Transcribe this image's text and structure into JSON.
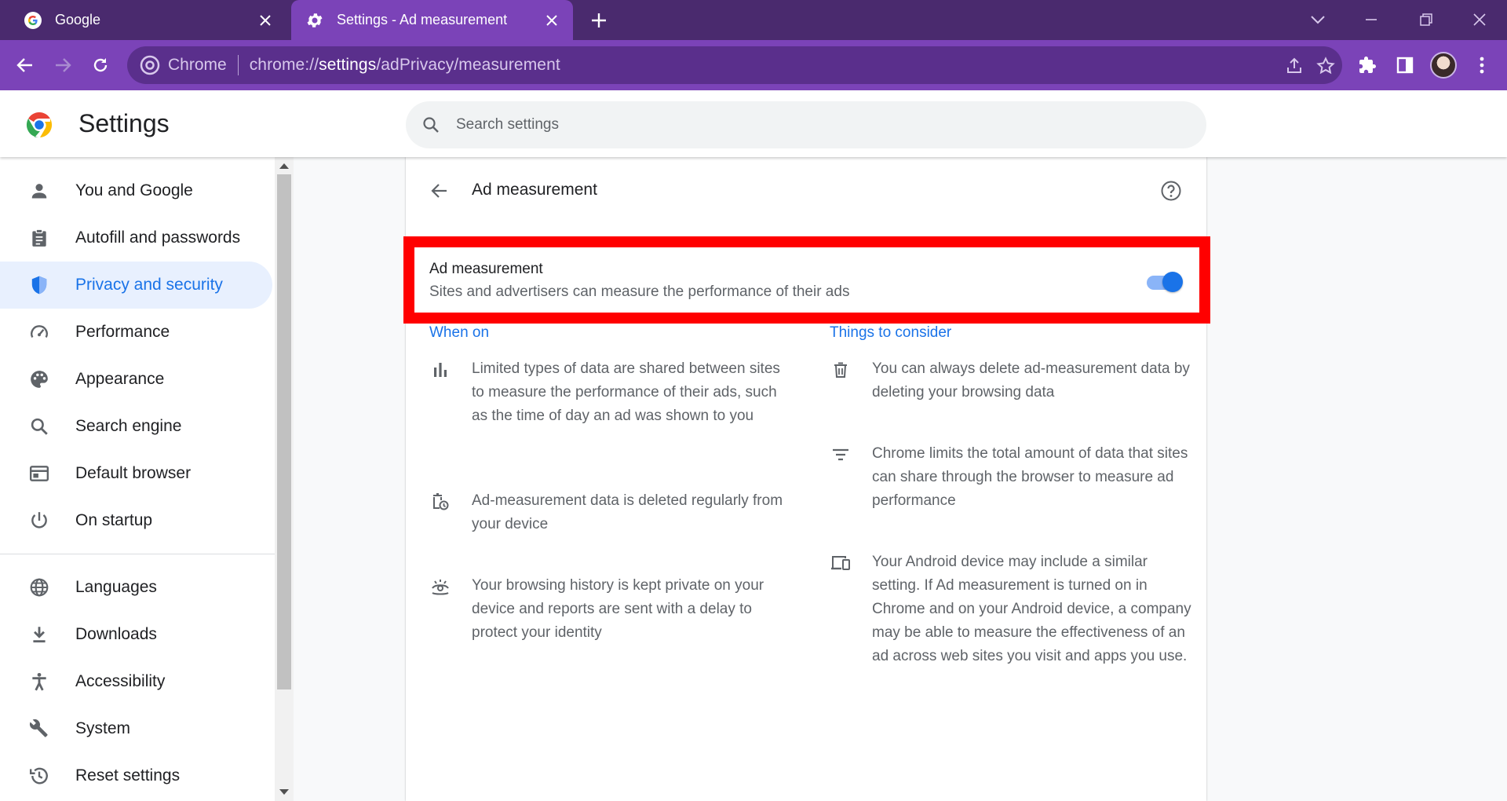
{
  "tabs": [
    {
      "title": "Google",
      "icon": "google-icon"
    },
    {
      "title": "Settings - Ad measurement",
      "icon": "gear-icon"
    }
  ],
  "omnibox": {
    "chip": "Chrome",
    "url_host": "chrome://",
    "url_bold": "settings",
    "url_path": "/adPrivacy/measurement"
  },
  "header": {
    "title": "Settings",
    "search_placeholder": "Search settings"
  },
  "sidebar": {
    "items": [
      {
        "label": "You and Google",
        "icon": "person-icon"
      },
      {
        "label": "Autofill and passwords",
        "icon": "clipboard-icon"
      },
      {
        "label": "Privacy and security",
        "icon": "shield-icon",
        "selected": true
      },
      {
        "label": "Performance",
        "icon": "speedometer-icon"
      },
      {
        "label": "Appearance",
        "icon": "palette-icon"
      },
      {
        "label": "Search engine",
        "icon": "search-icon"
      },
      {
        "label": "Default browser",
        "icon": "browser-window-icon"
      },
      {
        "label": "On startup",
        "icon": "power-icon"
      },
      {
        "label": "Languages",
        "icon": "globe-icon"
      },
      {
        "label": "Downloads",
        "icon": "download-icon"
      },
      {
        "label": "Accessibility",
        "icon": "accessibility-icon"
      },
      {
        "label": "System",
        "icon": "wrench-icon"
      },
      {
        "label": "Reset settings",
        "icon": "history-icon"
      }
    ]
  },
  "page": {
    "title": "Ad measurement",
    "toggle": {
      "title": "Ad measurement",
      "subtitle": "Sites and advertisers can measure the performance of their ads",
      "enabled": true
    },
    "when_on": {
      "heading": "When on",
      "items": [
        {
          "icon": "bar-chart-icon",
          "text": "Limited types of data are shared between sites to measure the performance of their ads, such as the time of day an ad was shown to you"
        },
        {
          "icon": "delete-clock-icon",
          "text": "Ad-measurement data is deleted regularly from your device"
        },
        {
          "icon": "private-view-icon",
          "text": "Your browsing history is kept private on your device and reports are sent with a delay to protect your identity"
        }
      ]
    },
    "consider": {
      "heading": "Things to consider",
      "items": [
        {
          "icon": "trash-icon",
          "text": "You can always delete ad-measurement data by deleting your browsing data"
        },
        {
          "icon": "filter-lines-icon",
          "text": "Chrome limits the total amount of data that sites can share through the browser to measure ad performance"
        },
        {
          "icon": "devices-icon",
          "text": "Your Android device may include a similar setting. If Ad measurement is turned on in Chrome and on your Android device, a company may be able to measure the effectiveness of an ad across web sites you visit and apps you use."
        }
      ]
    }
  },
  "colors": {
    "tabstrip": "#4a2a6e",
    "toolbar": "#7b43b8",
    "accent": "#1a73e8",
    "highlight": "#ff0000"
  }
}
